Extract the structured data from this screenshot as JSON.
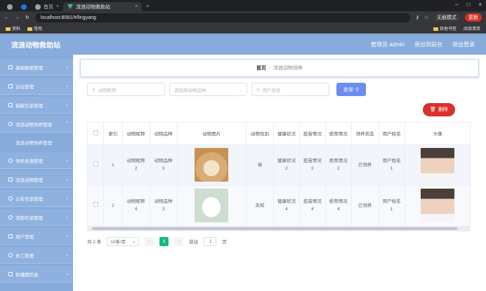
{
  "browser": {
    "tabs": [
      {
        "label": ""
      },
      {
        "label": ""
      },
      {
        "label": "首页"
      },
      {
        "label": "流浪动物救助站"
      }
    ],
    "url": "localhost:8081/#/lingyang",
    "incognito_label": "无痕模式",
    "update_label": "更新",
    "bookmarks": [
      "资料",
      "常用"
    ],
    "bookmarks_right": [
      "其他书签",
      "阅读清单"
    ]
  },
  "header": {
    "title": "流浪动物救助站",
    "admin_label": "管理员 admin",
    "backstage_label": "退出到前台",
    "logout_label": "退出登录"
  },
  "sidebar": {
    "items": [
      {
        "label": "基础数据管理"
      },
      {
        "label": "论坛管理"
      },
      {
        "label": "捐献信息管理"
      },
      {
        "label": "流浪动物领养管理"
      },
      {
        "label": "流浪动物领养管理",
        "sub": true
      },
      {
        "label": "领养反馈管理"
      },
      {
        "label": "流浪动物管理"
      },
      {
        "label": "公告信息管理"
      },
      {
        "label": "求助信息管理"
      },
      {
        "label": "用户管理"
      },
      {
        "label": "员工管理"
      },
      {
        "label": "轮播图信息"
      }
    ]
  },
  "breadcrumb": {
    "home": "首页",
    "separator": "/",
    "current": "流浪动物领养"
  },
  "search": {
    "name_placeholder": "动物昵称",
    "type_placeholder": "请选择动物品种",
    "user_placeholder": "用户姓名",
    "button_label": "查询"
  },
  "delete_label": "删除",
  "table": {
    "columns": [
      "",
      "索引",
      "动物昵称",
      "动物品种",
      "动物图片",
      "动物性别",
      "健康状况",
      "疫苗情况",
      "绝育情况",
      "领养状态",
      "用户姓名",
      "头像"
    ],
    "rows": [
      {
        "index": "1",
        "name": "动物昵称\n2",
        "type": "动物品种\n3",
        "image": "dog",
        "sex": "母",
        "health": "健康状况\n2",
        "vaccine": "疫苗情况\n2",
        "sterile": "绝育情况\n2",
        "status": "已领养",
        "user": "用户姓名\n1"
      },
      {
        "index": "2",
        "name": "动物昵称\n4",
        "type": "动物品种\n3",
        "image": "bear",
        "sex": "未知",
        "health": "健康状况\n4",
        "vaccine": "疫苗情况\n4",
        "sterile": "绝育情况\n4",
        "status": "已领养",
        "user": "用户姓名\n1"
      }
    ]
  },
  "pager": {
    "total": "共 2 条",
    "size": "10条/页",
    "prev": "<",
    "page": "1",
    "next": ">",
    "goto_label": "前往",
    "goto_value": "1",
    "page_unit": "页"
  }
}
